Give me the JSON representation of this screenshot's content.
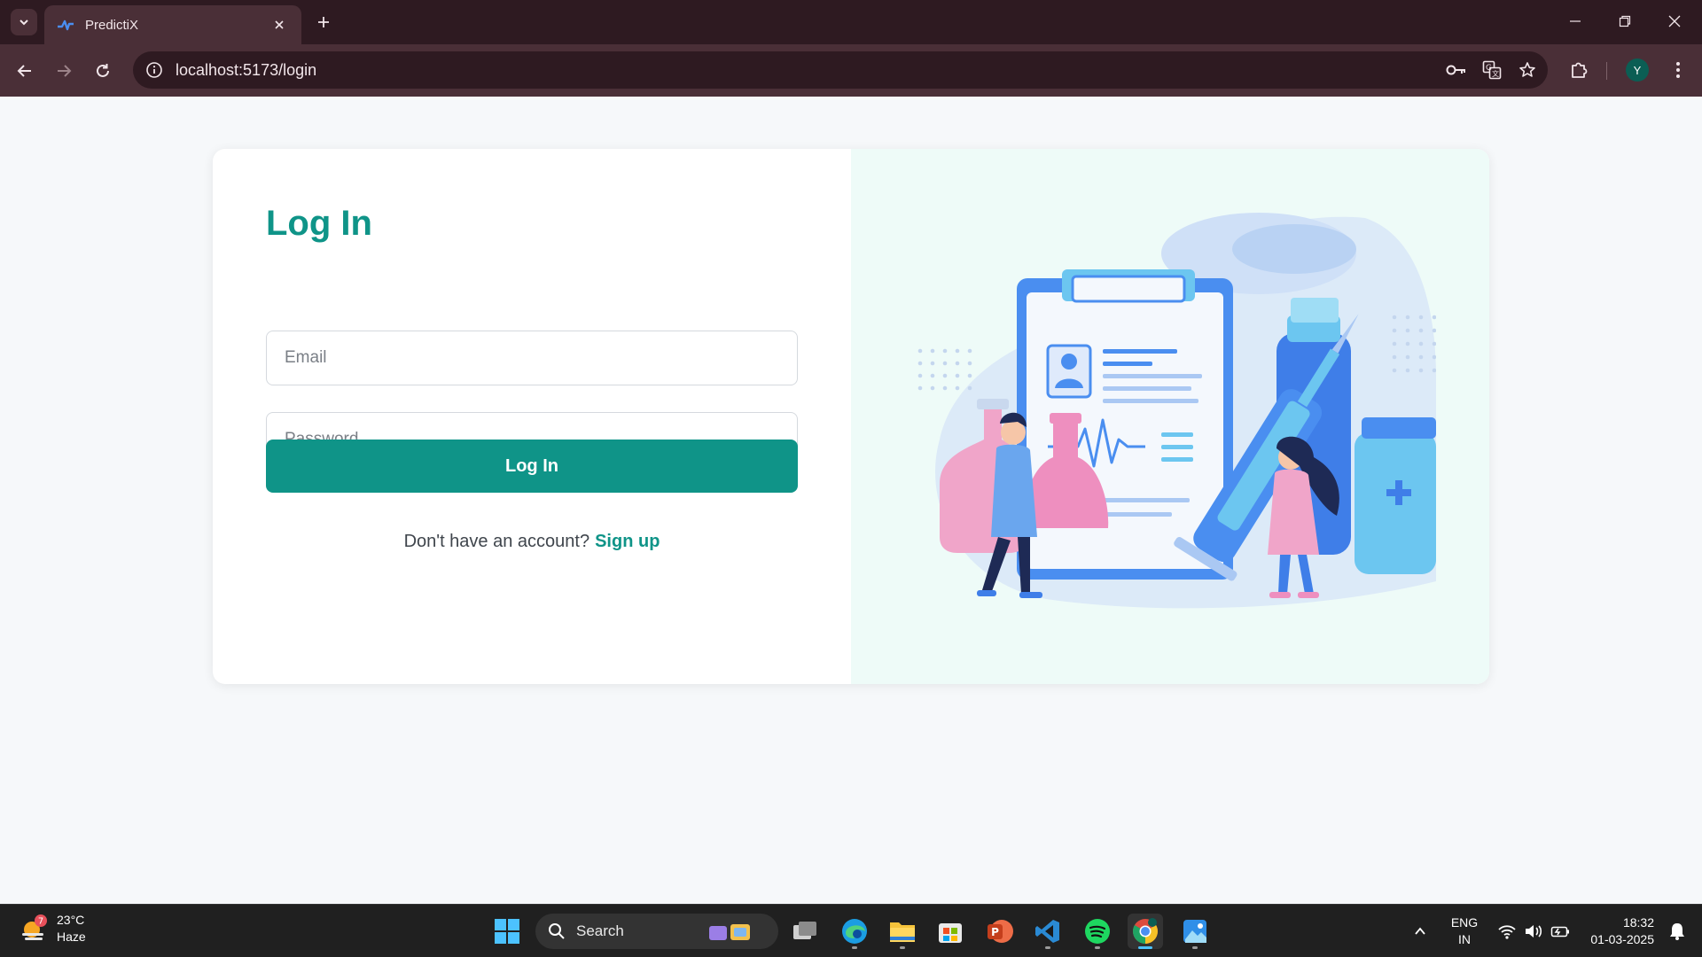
{
  "browser": {
    "tab_title": "PredictiX",
    "url": "localhost:5173/login",
    "profile_initial": "Y"
  },
  "login": {
    "heading": "Log In",
    "email_placeholder": "Email",
    "password_placeholder": "Password",
    "submit_label": "Log In",
    "signup_prompt": "Don't have an account?",
    "signup_link": "Sign up"
  },
  "taskbar": {
    "weather_badge": "7",
    "temperature": "23°C",
    "condition": "Haze",
    "search_label": "Search",
    "language_top": "ENG",
    "language_bottom": "IN",
    "time": "18:32",
    "date": "01-03-2025"
  },
  "colors": {
    "brand": "#0f9488",
    "chrome_dark": "#2e1a21",
    "chrome_light": "#4a2f37"
  },
  "icons": [
    "tab-search-icon",
    "predictix-favicon",
    "close-icon",
    "plus-icon",
    "minimize-icon",
    "restore-icon",
    "back-icon",
    "forward-icon",
    "reload-icon",
    "site-info-icon",
    "key-icon",
    "translate-icon",
    "star-icon",
    "extensions-icon",
    "profile-avatar",
    "menu-icon",
    "weather-icon",
    "windows-start-icon",
    "search-icon",
    "task-view-icon",
    "edge-icon",
    "file-explorer-icon",
    "store-icon",
    "powerpoint-icon",
    "vscode-icon",
    "spotify-icon",
    "chrome-icon",
    "photos-icon",
    "chevron-up-icon",
    "wifi-icon",
    "volume-icon",
    "battery-icon",
    "notification-icon"
  ]
}
